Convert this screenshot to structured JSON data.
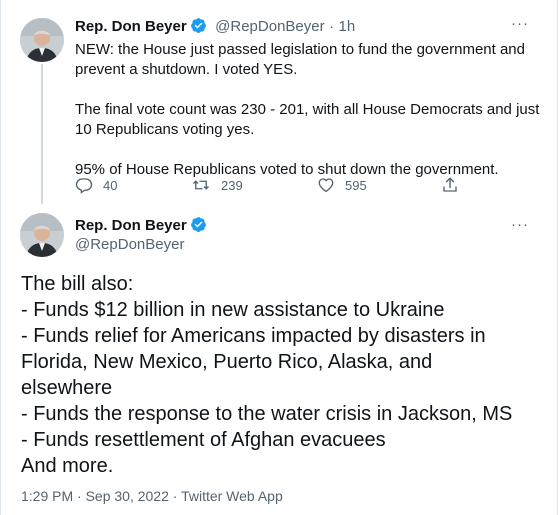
{
  "tweet1": {
    "name": "Rep. Don Beyer",
    "handle": "@RepDonBeyer",
    "separator": "·",
    "time": "1h",
    "more": "···",
    "paragraphs": [
      "NEW: the House just passed legislation to fund the government and prevent a shutdown. I voted YES.",
      "The final vote count was 230 - 201, with all House Democrats and just 10 Republicans voting yes.",
      "95% of House Republicans voted to shut down the government."
    ],
    "actions": {
      "replies": "40",
      "retweets": "239",
      "likes": "595"
    }
  },
  "tweet2": {
    "name": "Rep. Don Beyer",
    "handle": "@RepDonBeyer",
    "more": "···",
    "lines": [
      "The bill also:",
      "- Funds $12 billion in new assistance to Ukraine",
      "- Funds relief for Americans impacted by disasters in",
      "Florida, New Mexico, Puerto Rico, Alaska, and",
      "elsewhere",
      "- Funds the response to the water crisis in Jackson, MS",
      "- Funds resettlement of Afghan evacuees",
      "And more."
    ],
    "meta": "1:29 PM · Sep 30, 2022 · Twitter Web App"
  },
  "colors": {
    "verified": "#1d9bf0",
    "secondary_text": "#536471",
    "thread_line": "#cfd9de"
  },
  "icons": [
    "verified-badge-icon",
    "more-icon",
    "reply-icon",
    "retweet-icon",
    "like-icon",
    "share-icon"
  ]
}
